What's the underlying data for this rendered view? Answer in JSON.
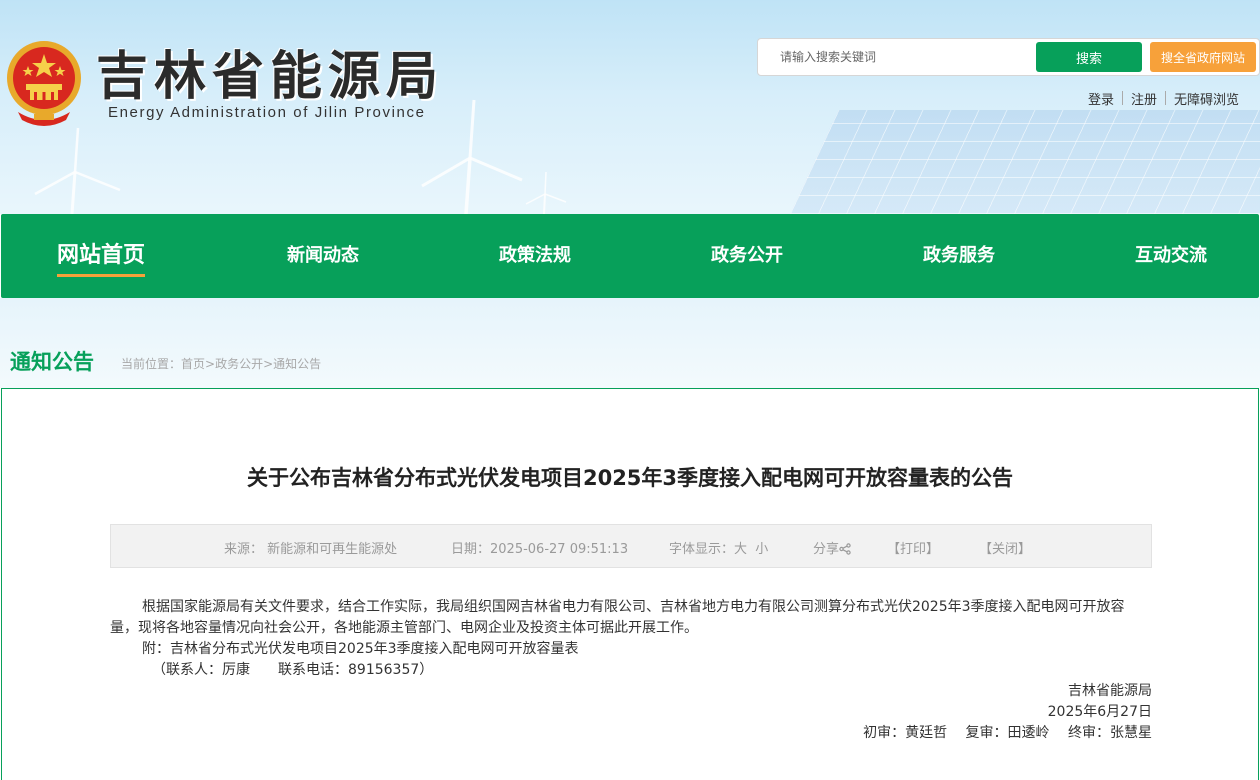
{
  "header": {
    "site_title": "吉林省能源局",
    "site_subtitle": "Energy Administration of Jilin Province",
    "search_placeholder": "请输入搜索关键词",
    "search_button": "搜索",
    "search_all_button": "搜全省政府网站",
    "user_links": [
      "登录",
      "注册",
      "无障碍浏览"
    ]
  },
  "nav": {
    "items": [
      "网站首页",
      "新闻动态",
      "政策法规",
      "政务公开",
      "政务服务",
      "互动交流"
    ]
  },
  "section": {
    "title": "通知公告",
    "breadcrumb_prefix": "当前位置：",
    "breadcrumb": [
      "首页",
      "政务公开",
      "通知公告"
    ],
    "breadcrumb_sep": ">"
  },
  "article": {
    "title": "关于公布吉林省分布式光伏发电项目2025年3季度接入配电网可开放容量表的公告",
    "meta": {
      "source_label": "来源：",
      "source": "新能源和可再生能源处",
      "date_label": "日期：",
      "date": "2025-06-27 09:51:13",
      "font_label": "字体显示：",
      "font_big": "大",
      "font_small": "小",
      "share": "分享",
      "print": "【打印】",
      "close": "【关闭】"
    },
    "paragraph": "根据国家能源局有关文件要求，结合工作实际，我局组织国网吉林省电力有限公司、吉林省地方电力有限公司测算分布式光伏2025年3季度接入配电网可开放容量，现将各地容量情况向社会公开，各地能源主管部门、电网企业及投资主体可据此开展工作。",
    "attachment_label": "附：",
    "attachment": "吉林省分布式光伏发电项目2025年3季度接入配电网可开放容量表",
    "contact": "（联系人：厉康　　联系电话：89156357）",
    "signature": "吉林省能源局",
    "sign_date": "2025年6月27日",
    "review": "初审：黄廷哲　 复审：田逶岭　 终审：张慧星"
  },
  "colors": {
    "brand_green": "#07a05a",
    "accent_orange": "#f7a13a"
  }
}
